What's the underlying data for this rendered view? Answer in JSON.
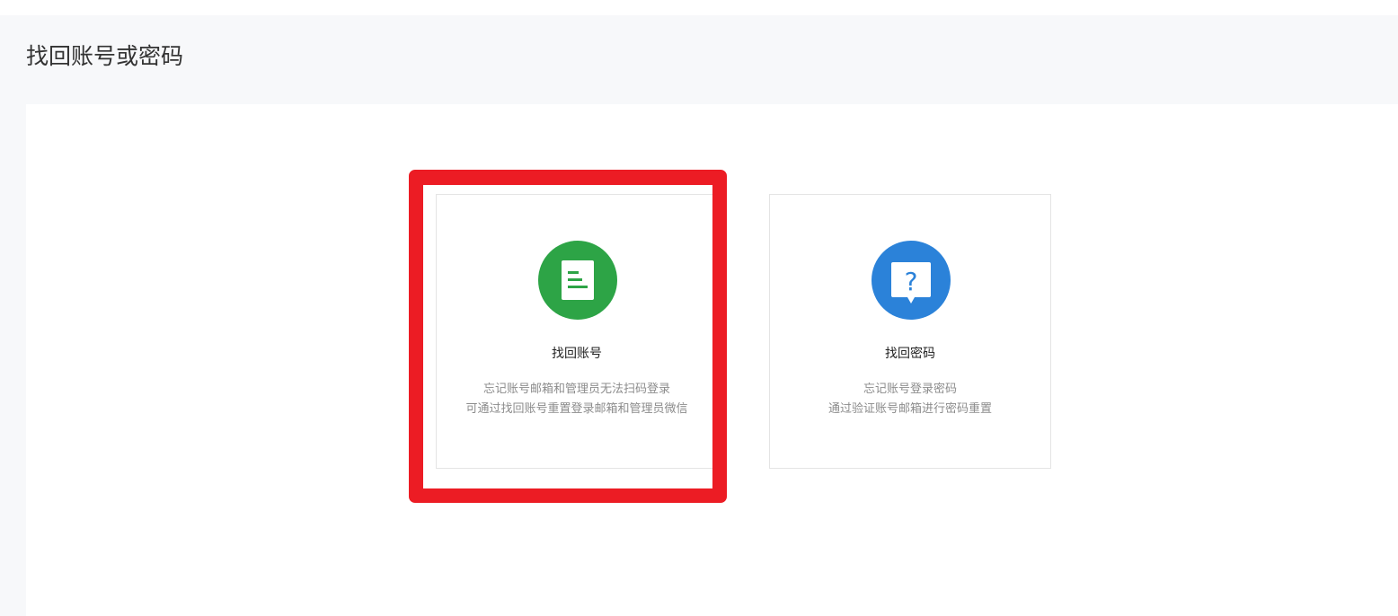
{
  "page": {
    "title": "找回账号或密码"
  },
  "cards": [
    {
      "title": "找回账号",
      "desc_lines": [
        "忘记账号邮箱和管理员无法扫码登录",
        "可通过找回账号重置登录邮箱和管理员微信"
      ],
      "icon": "document-icon",
      "icon_color": "#2da446"
    },
    {
      "title": "找回密码",
      "desc_lines": [
        "忘记账号登录密码",
        "通过验证账号邮箱进行密码重置"
      ],
      "icon": "question-bubble-icon",
      "icon_color": "#2b82d9"
    }
  ],
  "highlight_color": "#ec1c24"
}
